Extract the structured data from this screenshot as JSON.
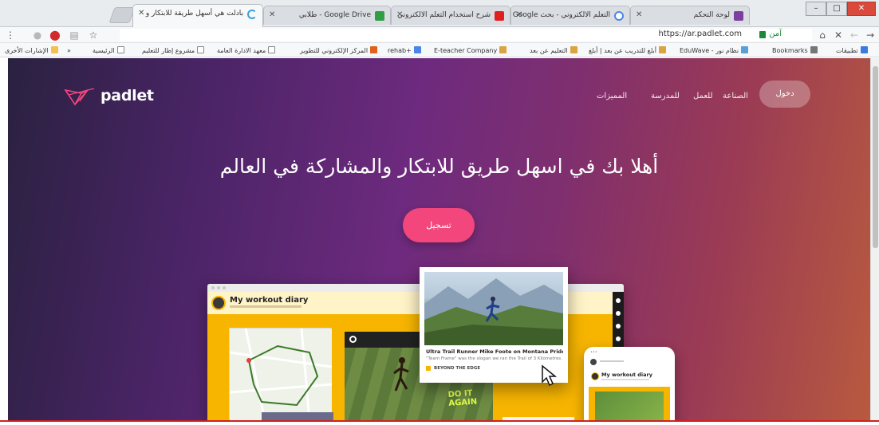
{
  "browser": {
    "tabs": [
      {
        "title": "بادلت هي أسهل طريقة للابتكار و",
        "favicon_color": "#3aa0d8",
        "active": true
      },
      {
        "title": "Google Drive - طلابي",
        "favicon_color": "#2f9e44",
        "active": false
      },
      {
        "title": "شرح استخدام التعلم الالكتروني",
        "favicon_color": "#e02020",
        "active": false
      },
      {
        "title": "التعلم الالكتروني - بحث Google",
        "favicon_color": "#4a86e8",
        "active": false
      },
      {
        "title": "لوحة التحكم",
        "favicon_color": "#7b3fa0",
        "active": false
      }
    ],
    "window_controls": {
      "minimize": "–",
      "maximize": "□",
      "close": "✕"
    },
    "address_bar": {
      "url": "https://ar.padlet.com",
      "secure_label": "آمن"
    },
    "bookmarks": [
      {
        "label": "تطبيقات",
        "icon_color": "#3b7be0"
      },
      {
        "label": "Bookmarks",
        "icon_color": "#777777"
      },
      {
        "label": "نظام نور - EduWave",
        "icon_color": "#5aa0d8"
      },
      {
        "label": "أبلغ للتدريب عن بعد | أبلغ",
        "icon_color": "#d9a441"
      },
      {
        "label": "التعليم عن بعد",
        "icon_color": "#d9a441"
      },
      {
        "label": "E-teacher Company",
        "icon_color": "#d9a441"
      },
      {
        "label": "+rehab",
        "icon_color": "#4a86e8"
      },
      {
        "label": "المركز الإلكتروني للتطوير",
        "icon_color": "#e06020"
      },
      {
        "label": "معهد الادارة العامة",
        "icon_color": "#888888"
      },
      {
        "label": "مشروع إطار للتعليم",
        "icon_color": "#888888"
      },
      {
        "label": "الرئيسية",
        "icon_color": "#888888"
      },
      {
        "label": "الإشارات الأخرى",
        "icon_color": "#f2c14e"
      }
    ]
  },
  "page": {
    "brand": {
      "name": "padlet"
    },
    "nav": [
      {
        "label": "الصناعة"
      },
      {
        "label": "للعمل"
      },
      {
        "label": "للمدرسة"
      },
      {
        "label": "المميزات"
      }
    ],
    "login_label": "دخول",
    "hero_heading": "أهلا بك في اسهل طريق للابتكار والمشاركة في العالم",
    "signup_label": "تسجيل",
    "colors": {
      "signup": "#f2467c",
      "mockup_yellow": "#f7b500"
    },
    "mockup": {
      "desktop_title": "My workout diary",
      "track_text": "DO IT AGAIN",
      "photo_caption": "Ultra Trail Runner Mike Foote on Montana Pride, Yurt ...",
      "photo_desc": "\"Team Frame\" was the slogan we ran the Trail of 3 Kilometres ...",
      "photo_source": "BEYOND THE EDGE",
      "phone_title": "My workout diary"
    }
  }
}
